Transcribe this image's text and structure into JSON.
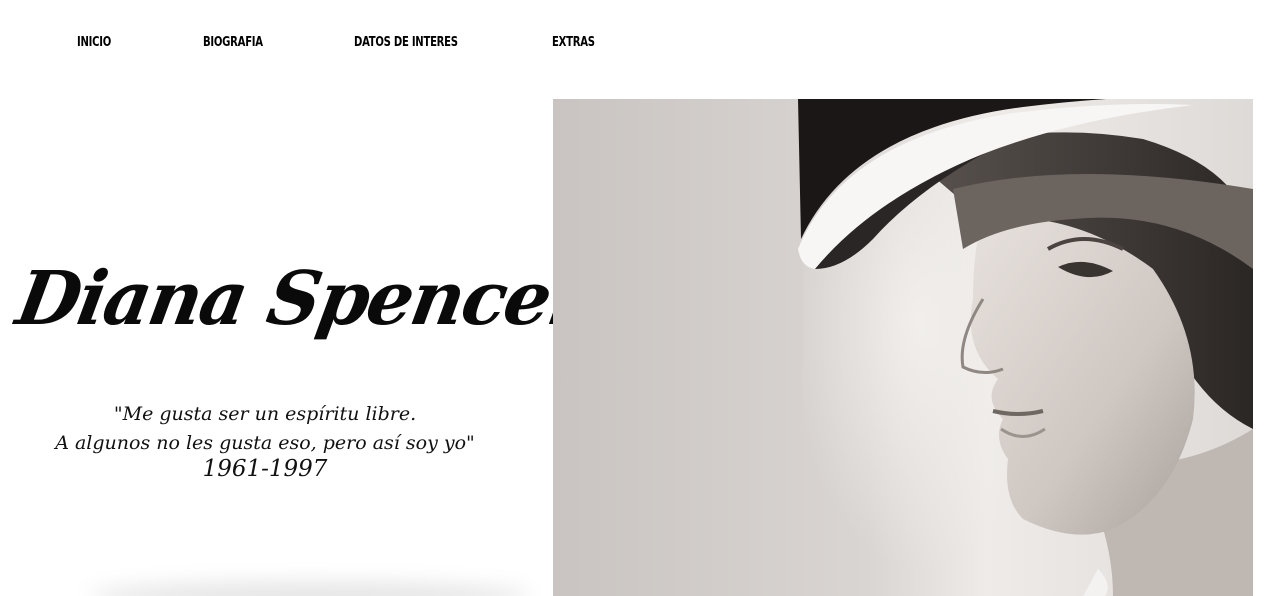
{
  "nav": {
    "items": [
      {
        "label": "INICIO"
      },
      {
        "label": "BIOGRAFIA"
      },
      {
        "label": "DATOS DE INTERES"
      },
      {
        "label": "EXTRAS"
      }
    ]
  },
  "hero": {
    "title": "Diana Spencer",
    "quote_line1": "\"Me gusta ser un espíritu libre.",
    "quote_line2": "A algunos no les gusta eso, pero así soy yo\"",
    "years": "1961-1997"
  },
  "colors": {
    "background": "#ffffff",
    "text": "#000000",
    "photo_tone": "#c9c4c1"
  },
  "icons": {
    "portrait": "photo-portrait"
  }
}
